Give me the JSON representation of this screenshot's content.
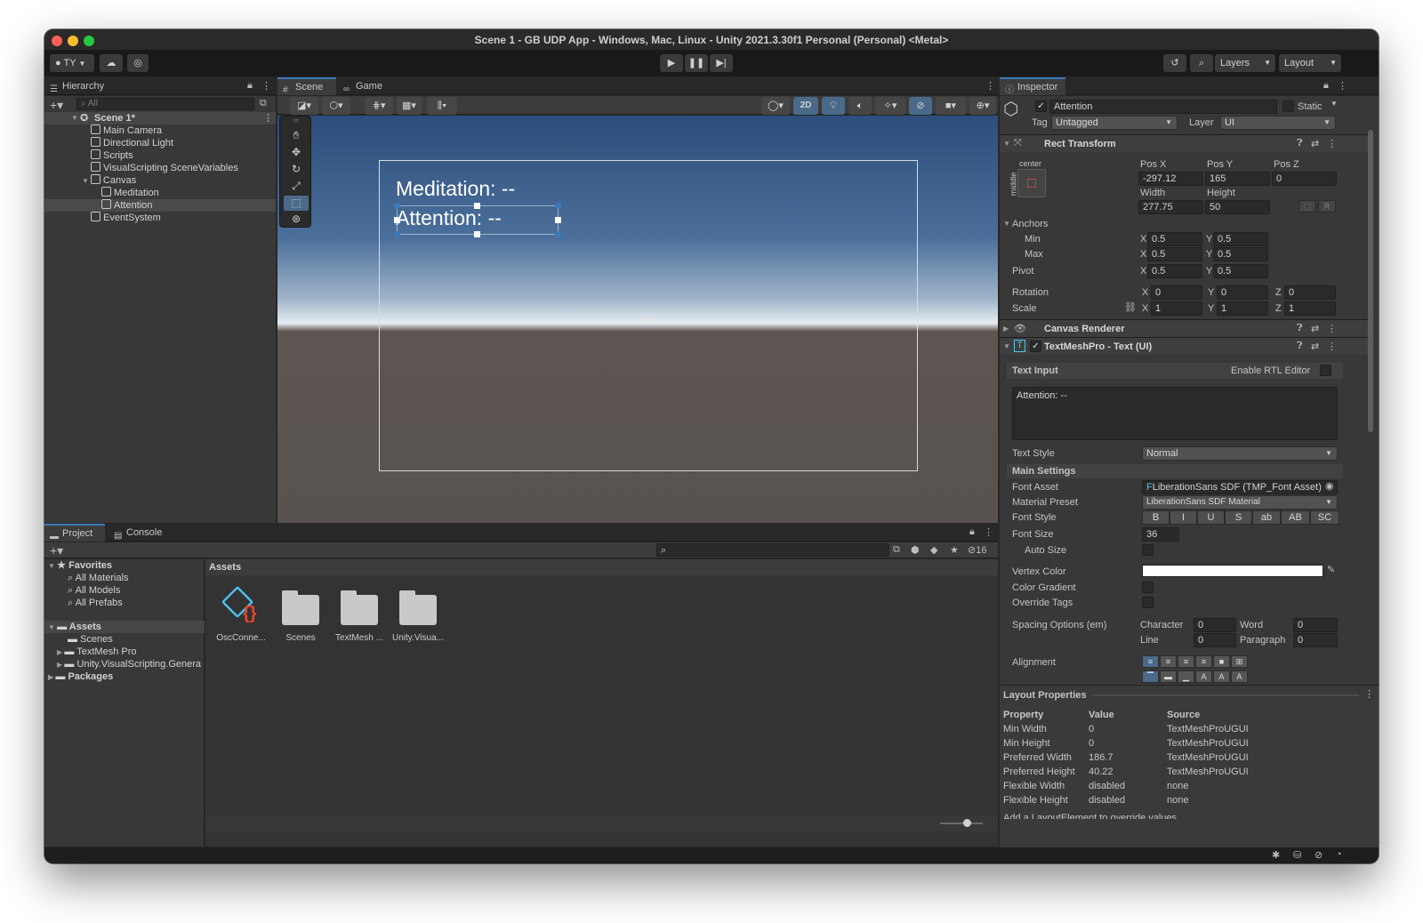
{
  "window": {
    "title": "Scene 1 - GB UDP App - Windows, Mac, Linux - Unity 2021.3.30f1 Personal (Personal) <Metal>"
  },
  "toolbar": {
    "account_label": "TY",
    "layers_label": "Layers",
    "layout_label": "Layout"
  },
  "hierarchy": {
    "tab_label": "Hierarchy",
    "search_placeholder": "All",
    "scene_label": "Scene 1*",
    "items": [
      {
        "label": "Main Camera"
      },
      {
        "label": "Directional Light"
      },
      {
        "label": "Scripts"
      },
      {
        "label": "VisualScripting SceneVariables"
      },
      {
        "label": "Canvas"
      },
      {
        "label": "Meditation"
      },
      {
        "label": "Attention"
      },
      {
        "label": "EventSystem"
      }
    ]
  },
  "scene_view": {
    "tabs": [
      {
        "label": "Scene"
      },
      {
        "label": "Game"
      }
    ],
    "mode_2d_label": "2D",
    "text_meditation": "Meditation: --",
    "text_attention": "Attention: --"
  },
  "project": {
    "tabs": [
      {
        "label": "Project"
      },
      {
        "label": "Console"
      }
    ],
    "hidden_count": "16",
    "favorites_label": "Favorites",
    "favorites": [
      {
        "label": "All Materials"
      },
      {
        "label": "All Models"
      },
      {
        "label": "All Prefabs"
      }
    ],
    "assets_label": "Assets",
    "asset_folders": [
      {
        "label": "Scenes"
      },
      {
        "label": "TextMesh Pro"
      },
      {
        "label": "Unity.VisualScripting.Genera"
      }
    ],
    "packages_label": "Packages",
    "breadcrumb": "Assets",
    "grid_items": [
      {
        "label": "OscConne..."
      },
      {
        "label": "Scenes"
      },
      {
        "label": "TextMesh ..."
      },
      {
        "label": "Unity.Visua..."
      }
    ]
  },
  "inspector": {
    "tab_label": "Inspector",
    "object_name": "Attention",
    "static_label": "Static",
    "tag_label": "Tag",
    "tag_value": "Untagged",
    "layer_label": "Layer",
    "layer_value": "UI",
    "rect_transform": {
      "title": "Rect Transform",
      "anchor_h": "center",
      "anchor_v": "middle",
      "posx_label": "Pos X",
      "posx": "-297.12",
      "posy_label": "Pos Y",
      "posy": "165",
      "posz_label": "Pos Z",
      "posz": "0",
      "width_label": "Width",
      "width": "277.75",
      "height_label": "Height",
      "height": "50",
      "r_label": "R",
      "anchors_label": "Anchors",
      "min_label": "Min",
      "min_x": "0.5",
      "min_y": "0.5",
      "max_label": "Max",
      "max_x": "0.5",
      "max_y": "0.5",
      "pivot_label": "Pivot",
      "pivot_x": "0.5",
      "pivot_y": "0.5",
      "rotation_label": "Rotation",
      "rot_x": "0",
      "rot_y": "0",
      "rot_z": "0",
      "scale_label": "Scale",
      "scale_x": "1",
      "scale_y": "1",
      "scale_z": "1",
      "x": "X",
      "y": "Y",
      "z": "Z"
    },
    "canvas_renderer": {
      "title": "Canvas Renderer"
    },
    "tmp": {
      "title": "TextMeshPro - Text (UI)",
      "text_input_label": "Text Input",
      "rtl_label": "Enable RTL Editor",
      "text_value": "Attention: --",
      "text_style_label": "Text Style",
      "text_style_value": "Normal",
      "main_settings_label": "Main Settings",
      "font_asset_label": "Font Asset",
      "font_asset_value": "LiberationSans SDF (TMP_Font Asset)",
      "material_preset_label": "Material Preset",
      "material_preset_value": "LiberationSans SDF Material",
      "font_style_label": "Font Style",
      "font_style_buttons": [
        "B",
        "I",
        "U",
        "S",
        "ab",
        "AB",
        "SC"
      ],
      "font_size_label": "Font Size",
      "font_size_value": "36",
      "auto_size_label": "Auto Size",
      "vertex_color_label": "Vertex Color",
      "vertex_color": "#ffffff",
      "color_gradient_label": "Color Gradient",
      "override_tags_label": "Override Tags",
      "spacing_label": "Spacing Options (em)",
      "character_label": "Character",
      "character_value": "0",
      "word_label": "Word",
      "word_value": "0",
      "line_label": "Line",
      "line_value": "0",
      "paragraph_label": "Paragraph",
      "paragraph_value": "0",
      "alignment_label": "Alignment"
    }
  },
  "layout_properties": {
    "title": "Layout Properties",
    "headers": [
      "Property",
      "Value",
      "Source"
    ],
    "rows": [
      [
        "Min Width",
        "0",
        "TextMeshProUGUI"
      ],
      [
        "Min Height",
        "0",
        "TextMeshProUGUI"
      ],
      [
        "Preferred Width",
        "186.7",
        "TextMeshProUGUI"
      ],
      [
        "Preferred Height",
        "40.22",
        "TextMeshProUGUI"
      ],
      [
        "Flexible Width",
        "disabled",
        "none"
      ],
      [
        "Flexible Height",
        "disabled",
        "none"
      ]
    ],
    "footer": "Add a LayoutElement to override values"
  },
  "colors": {
    "accent": "#3a79bb",
    "selection": "#2c5d87"
  }
}
